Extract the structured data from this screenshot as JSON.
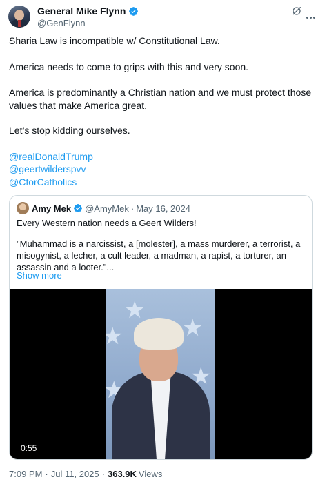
{
  "author": {
    "display_name": "General Mike Flynn",
    "handle": "@GenFlynn"
  },
  "tweet": {
    "paragraphs": [
      "Sharia Law is incompatible w/ Constitutional Law.",
      "America needs to come to grips with this and very soon.",
      "America is predominantly a Christian nation and we must protect those values that make America great.",
      "Let’s stop kidding ourselves."
    ],
    "mentions": [
      "@realDonaldTrump",
      "@geertwilderspvv",
      "@CforCatholics"
    ]
  },
  "quote": {
    "display_name": "Amy Mek",
    "handle": "@AmyMek",
    "dot": "·",
    "date": "May 16, 2024",
    "line1": "Every Western nation needs a Geert Wilders!",
    "line2": "\"Muhammad is a narcissist, a [molester], a mass murderer, a terrorist, a misogynist, a lecher, a cult leader, a madman, a rapist, a torturer, an assassin and a looter.\"...",
    "show_more": "Show more",
    "video_time": "0:55"
  },
  "footer": {
    "time": "7:09 PM",
    "sep": "·",
    "date": "Jul 11, 2025",
    "views_count": "363.9K",
    "views_label": "Views"
  },
  "colors": {
    "accent": "#1d9bf0",
    "secondary_text": "#536471",
    "primary_text": "#0f1419"
  },
  "icons": {
    "verified": "verified-badge-icon",
    "grok": "grok-icon",
    "more": "more-icon"
  }
}
